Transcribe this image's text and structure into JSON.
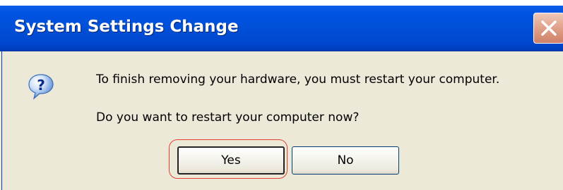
{
  "dialog": {
    "title": "System Settings Change",
    "message": "To finish removing your hardware, you must restart your computer.",
    "question": "Do you want to restart your computer now?",
    "buttons": {
      "yes_label": "Yes",
      "no_label": "No"
    },
    "icon": "question-icon"
  },
  "colors": {
    "titlebar": "#0054e3",
    "dialog_background": "#ece9d8",
    "highlight": "#e84030"
  }
}
